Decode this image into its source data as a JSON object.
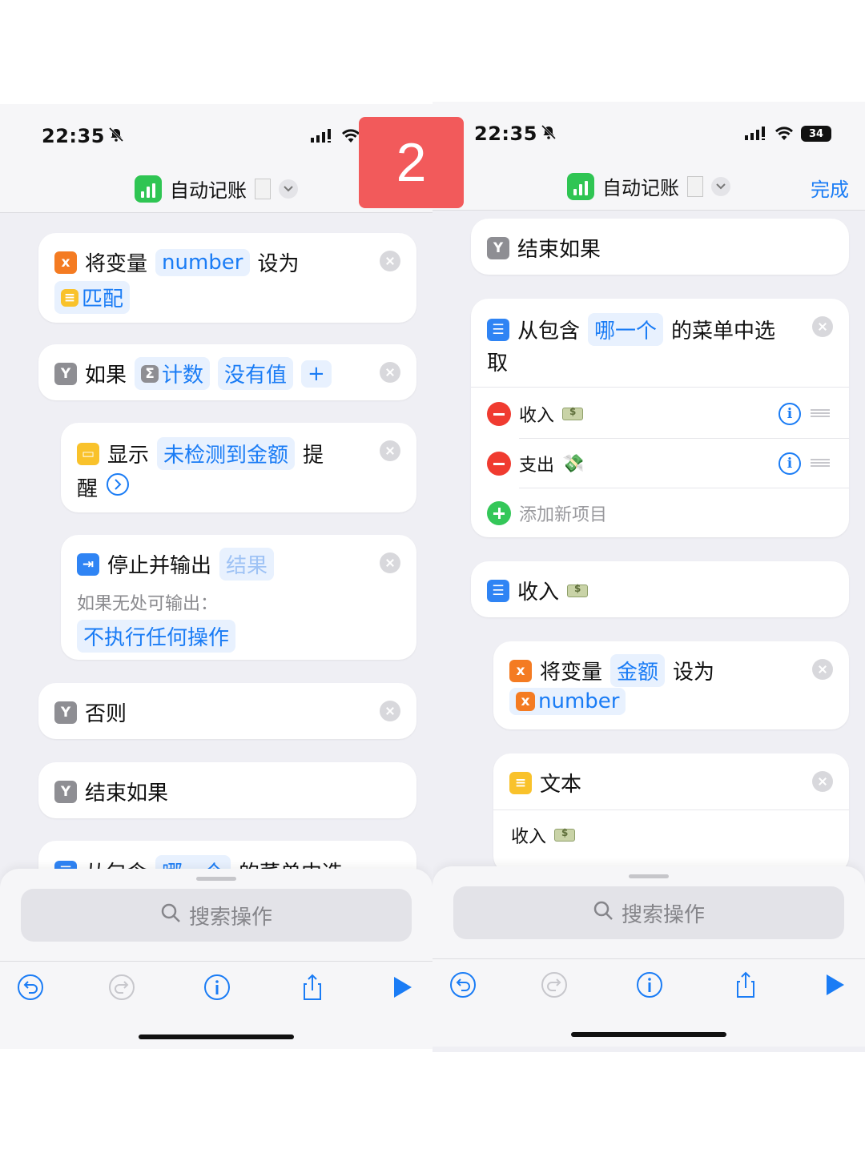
{
  "badge": "2",
  "left": {
    "status": {
      "time": "22:35"
    },
    "header": {
      "title": "自动记账"
    },
    "cards": {
      "set_var": {
        "prefix": "将变量",
        "var": "number",
        "suffix": "设为",
        "value": "匹配"
      },
      "if": {
        "label": "如果",
        "var": "计数",
        "cond": "没有值",
        "add": "+"
      },
      "alert": {
        "prefix": "显示",
        "token": "未检测到金额",
        "suffix": "提",
        "line2": "醒"
      },
      "stop": {
        "label": "停止并输出",
        "token": "结果",
        "note": "如果无处可输出：",
        "option": "不执行任何操作"
      },
      "otherwise": {
        "label": "否则"
      },
      "endif": {
        "label": "结束如果"
      },
      "menu_peek": {
        "prefix": "从包含",
        "token": "哪一个",
        "suffix": "的菜单中选"
      }
    },
    "search": {
      "placeholder": "搜索操作"
    }
  },
  "right": {
    "status": {
      "time": "22:35",
      "battery": "34"
    },
    "header": {
      "title": "自动记账",
      "done": "完成"
    },
    "cards": {
      "endif": {
        "label": "结束如果"
      },
      "menu": {
        "prefix": "从包含",
        "token": "哪一个",
        "suffix": "的菜单中选",
        "line2": "取",
        "items": [
          {
            "label": "收入"
          },
          {
            "label": "支出"
          }
        ],
        "add": "添加新项目"
      },
      "income": {
        "label": "收入"
      },
      "set_var": {
        "prefix": "将变量",
        "var": "金额",
        "suffix": "设为",
        "value": "number"
      },
      "text": {
        "label": "文本",
        "content": "收入"
      }
    },
    "search": {
      "placeholder": "搜索操作"
    }
  }
}
